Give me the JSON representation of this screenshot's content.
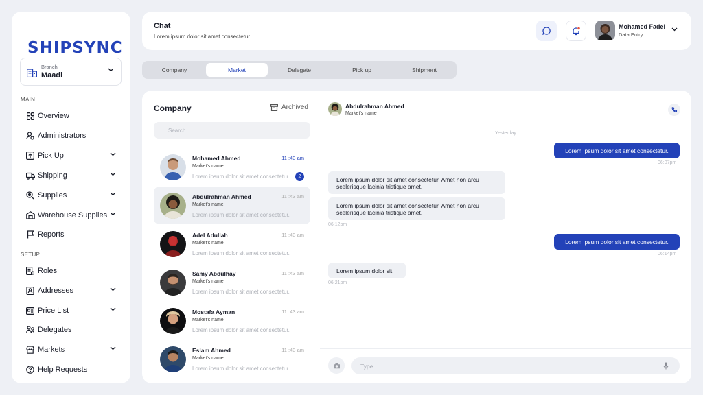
{
  "logo": "SHIPSYNC",
  "branch": {
    "label": "Branch",
    "value": "Maadi"
  },
  "sidebar": {
    "main_label": "MAIN",
    "setup_label": "SETUP",
    "items": [
      {
        "label": "Overview",
        "icon": "grid-icon"
      },
      {
        "label": "Administrators",
        "icon": "user-gear-icon"
      },
      {
        "label": "Pick Up",
        "icon": "box-up-icon"
      },
      {
        "label": "Shipping",
        "icon": "truck-icon"
      },
      {
        "label": "Supplies",
        "icon": "search-box-icon"
      },
      {
        "label": "Warehouse Supplies",
        "icon": "warehouse-icon"
      },
      {
        "label": "Reports",
        "icon": "flag-icon"
      },
      {
        "label": "Roles",
        "icon": "roles-icon"
      },
      {
        "label": "Addresses",
        "icon": "address-book-icon"
      },
      {
        "label": "Price List",
        "icon": "price-tag-icon"
      },
      {
        "label": "Delegates",
        "icon": "delegates-icon"
      },
      {
        "label": "Markets",
        "icon": "store-icon"
      },
      {
        "label": "Help Requests",
        "icon": "help-icon"
      }
    ]
  },
  "header": {
    "title": "Chat",
    "subtitle": "Lorem ipsum dolor sit amet consectetur.",
    "user_name": "Mohamed Fadel",
    "user_role": "Data Entry"
  },
  "tabs": [
    "Company",
    "Market",
    "Delegate",
    "Pick up",
    "Shipment"
  ],
  "conversations_panel": {
    "title": "Company",
    "archived_label": "Archived",
    "search_placeholder": "Search"
  },
  "conversations": [
    {
      "name": "Mohamed Ahmed",
      "sub": "Market's name",
      "message": "Lorem ipsum dolor sit amet consectetur.",
      "time": "11 :43 am",
      "unread": "2"
    },
    {
      "name": "Abdulrahman Ahmed",
      "sub": "Market's name",
      "message": "Lorem ipsum dolor sit amet consectetur.",
      "time": "11 :43 am"
    },
    {
      "name": "Adel Adullah",
      "sub": "Market's name",
      "message": "Lorem ipsum dolor sit amet consectetur.",
      "time": "11 :43 am"
    },
    {
      "name": "Samy Abdulhay",
      "sub": "Market's name",
      "message": "Lorem ipsum dolor sit amet consectetur.",
      "time": "11 :43 am"
    },
    {
      "name": "Mostafa Ayman",
      "sub": "Market's name",
      "message": "Lorem ipsum dolor sit amet consectetur.",
      "time": "11 :43 am"
    },
    {
      "name": "Eslam Ahmed",
      "sub": "Market's name",
      "message": "Lorem ipsum dolor sit amet consectetur.",
      "time": "11 :43 am"
    }
  ],
  "chat": {
    "contact_name": "Abdulrahman Ahmed",
    "contact_sub": "Market's name",
    "day_separator": "Yesterday",
    "messages": [
      {
        "text": "Lorem ipsum dolor sit amet consectetur.",
        "time": "06:07pm"
      },
      {
        "text": "Lorem ipsum dolor sit amet consectetur. Amet non arcu scelerisque lacinia tristique amet."
      },
      {
        "text": "Lorem ipsum dolor sit amet consectetur. Amet non arcu scelerisque lacinia tristique amet.",
        "time": "06:12pm"
      },
      {
        "text": "Lorem ipsum dolor sit amet consectetur.",
        "time": "06:14pm"
      },
      {
        "text": "Lorem ipsum dolor sit.",
        "time": "06:21pm"
      }
    ],
    "composer_placeholder": "Type"
  },
  "colors": {
    "accent": "#2342b8",
    "background": "#eef0f5",
    "bubble_in": "#eef0f4"
  }
}
